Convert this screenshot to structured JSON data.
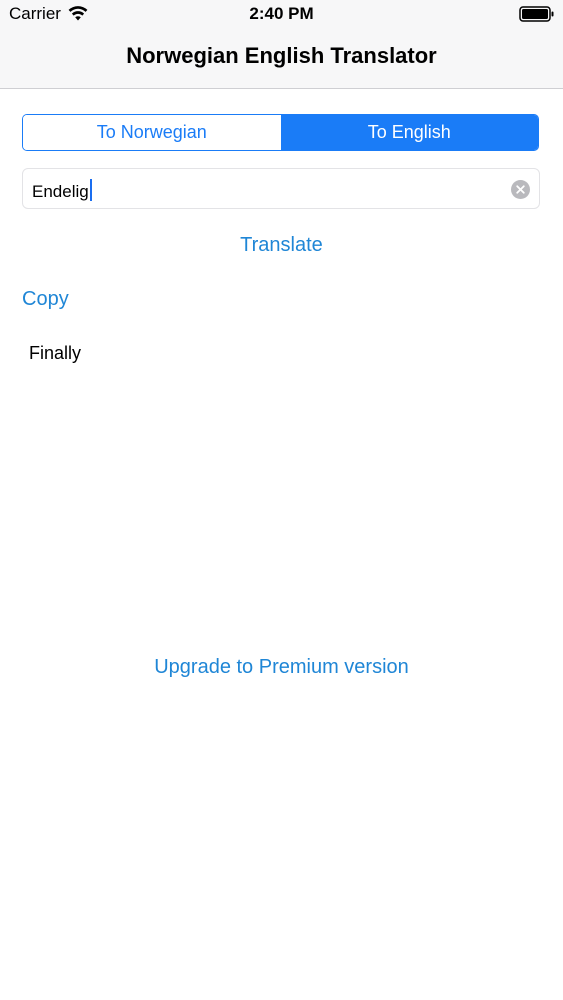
{
  "status_bar": {
    "carrier": "Carrier",
    "time": "2:40 PM",
    "wifi_icon": "wifi-icon",
    "battery_icon": "battery-icon"
  },
  "nav": {
    "title": "Norwegian English Translator"
  },
  "segments": {
    "to_norwegian": "To Norwegian",
    "to_english": "To English",
    "selected": "To English"
  },
  "input": {
    "value": "Endelig",
    "clear_icon": "clear-icon"
  },
  "actions": {
    "translate": "Translate",
    "copy": "Copy",
    "upgrade": "Upgrade to Premium version"
  },
  "result": {
    "text": "Finally"
  },
  "colors": {
    "accent": "#1a7cf7",
    "link": "#1f86d6",
    "nav_bg": "#f7f7f8"
  }
}
